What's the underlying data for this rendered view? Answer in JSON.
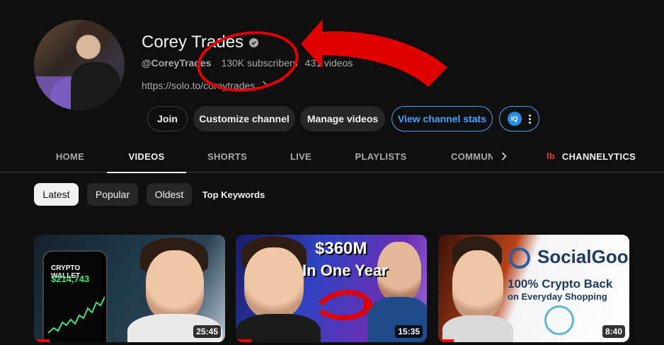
{
  "channel": {
    "name": "Corey Trades",
    "handle": "@CoreyTrades",
    "subscribers": "130K subscribers",
    "videos": "431 videos",
    "link": "https://solo.to/coreytrades"
  },
  "actions": {
    "join": "Join",
    "customize": "Customize channel",
    "manage": "Manage videos",
    "stats": "View channel stats",
    "extension_logo": "IQ"
  },
  "tabs": {
    "home": "HOME",
    "videos": "VIDEOS",
    "shorts": "SHORTS",
    "live": "LIVE",
    "playlists": "PLAYLISTS",
    "community": "COMMUNITY",
    "channelytics": "CHANNELYTICS",
    "channelytics_icon": "fb",
    "active": "videos"
  },
  "filters": {
    "latest": "Latest",
    "popular": "Popular",
    "oldest": "Oldest",
    "keywords": "Top Keywords",
    "selected": "latest"
  },
  "videos": [
    {
      "duration": "25:45",
      "progress": 0.08,
      "overlay_title": "CRYPTO WALLET",
      "overlay_value": "$214,743"
    },
    {
      "duration": "15:35",
      "progress": 0.08,
      "overlay_title": "$360M",
      "overlay_sub": "In One Year"
    },
    {
      "duration": "8:40",
      "progress": 0.08,
      "overlay_brand": "SocialGood",
      "overlay_line1": "100% Crypto Back",
      "overlay_line2": "on Everyday Shopping"
    }
  ],
  "colors": {
    "background": "#0f0f0f",
    "accent_blue": "#3ea6ff",
    "annotation_red": "#e00000",
    "progress_red": "#ff0000"
  },
  "icons": [
    "verified-icon",
    "chevron-right-icon",
    "kebab-icon",
    "channelytics-icon"
  ]
}
